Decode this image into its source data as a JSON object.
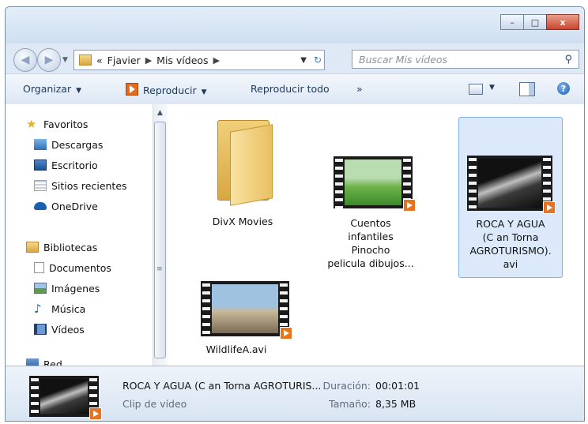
{
  "window": {
    "controls": {
      "minimize": "–",
      "maximize": "□",
      "close": "x"
    }
  },
  "nav": {
    "back_icon": "back-arrow-icon",
    "forward_icon": "forward-arrow-icon",
    "address": {
      "overflow": "«",
      "crumbs": [
        "Fjavier",
        "Mis vídeos"
      ]
    },
    "search_placeholder": "Buscar Mis vídeos"
  },
  "toolbar": {
    "organize": "Organizar",
    "play": "Reproducir",
    "play_all": "Reproducir todo",
    "more": "»",
    "help": "?"
  },
  "sidebar": {
    "favorites_label": "Favoritos",
    "favorites": [
      "Descargas",
      "Escritorio",
      "Sitios recientes",
      "OneDrive"
    ],
    "libraries_label": "Bibliotecas",
    "libraries": [
      "Documentos",
      "Imágenes",
      "Música",
      "Vídeos"
    ],
    "network_label": "Red"
  },
  "files": [
    {
      "name": "DivX Movies",
      "kind": "folder"
    },
    {
      "name": "Cuentos infantiles Pinocho pelicula dibujos...",
      "lines": [
        "Cuentos",
        "infantiles",
        "Pinocho",
        "pelicula dibujos..."
      ],
      "kind": "video"
    },
    {
      "name": "ROCA Y AGUA (C an Torna AGROTURISMO).avi",
      "lines": [
        "ROCA Y AGUA",
        "(C an Torna",
        "AGROTURISMO).",
        "avi"
      ],
      "kind": "video",
      "selected": true
    },
    {
      "name": "WildlifeA.avi",
      "kind": "video"
    }
  ],
  "details": {
    "name": "ROCA Y AGUA  (C an Torna AGROTURIS...",
    "type": "Clip de vídeo",
    "duration_label": "Duración:",
    "duration": "00:01:01",
    "size_label": "Tamaño:",
    "size": "8,35 MB"
  },
  "colors": {
    "accent_play": "#e46a1c",
    "selection": "#dbe9fa",
    "close": "#c9462c"
  }
}
